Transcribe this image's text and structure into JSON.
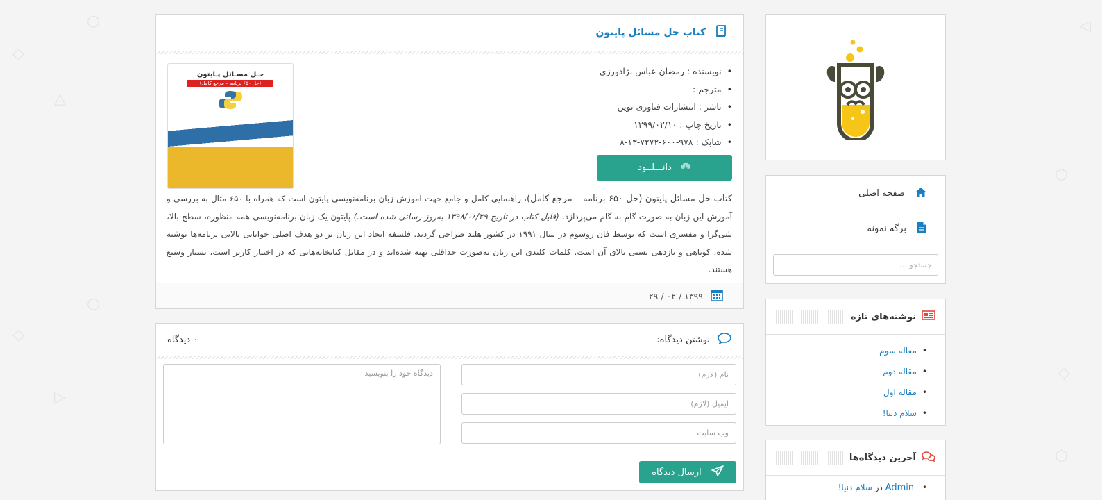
{
  "post": {
    "title": "کتاب حل مسائل پایتون",
    "meta": [
      "نویسنده : رمضان عباس نژادورزی",
      "مترجم : –",
      "ناشر : انتشارات فناوری نوین",
      "تاریخ چاپ : ۱۳۹۹/۰۲/۱۰",
      "شابک : ۹۷۸-۶۰۰-۷۲۷۲-۱۳-۸"
    ],
    "download_label": "دانـــلــود",
    "description_lead": "کتاب حل مسائل پایتون (حل ۶۵۰ برنامه – مرجع کامل)",
    "description_1": "، راهنمایی کامل و جامع جهت آموزش زبان برنامه‌نویسی پایتون است که همراه با ۶۵۰ مثال به بررسی و آموزش این زبان به صورت گام به گام می‌پردازد. ",
    "description_italic": "(فایل کتاب در تاریخ ۱۳۹۸/۰۸/۲۹ به‌روز رسانی شده است.)",
    "description_2": " پایتون یک زبان برنامه‌نویسی همه منظوره، سطح بالا، شی‌گرا و مفسری است که توسط فان روسوم در سال ۱۹۹۱ در کشور هلند طراحی گردید. فلسفه ایجاد این زبان بر دو هدف اصلی خوانایی بالایی برنامه‌ها نوشته شده، کوتاهی و بازدهی نسبی بالای آن است. کلمات کلیدی این زبان به‌صورت حداقلی تهیه شده‌اند و در مقابل کتابخانه‌هایی که در اختیار کاربر است، بسیار وسیع هستند.",
    "date": "۱۳۹۹ / ۰۲ / ۲۹",
    "cover": {
      "title": "حـل مسـائل پـایتون",
      "subtitle": "(حل ۶۵۰ برنامه – مرجع کامل)"
    }
  },
  "comments": {
    "title": "نوشتن دیدگاه:",
    "count": "۰ دیدگاه",
    "name_placeholder": "نام (لازم)",
    "email_placeholder": "ایمیل (لازم)",
    "website_placeholder": "وب سایت",
    "comment_placeholder": "دیدگاه خود را بنویسید",
    "submit_label": "ارسال دیدگاه"
  },
  "sidebar": {
    "nav": [
      {
        "label": "صفحه اصلی",
        "icon": "home-icon"
      },
      {
        "label": "برگه نمونه",
        "icon": "file-icon"
      }
    ],
    "search_placeholder": "جستجو ...",
    "recent_title": "نوشته‌های تازه",
    "recent_posts": [
      "مقاله سوم",
      "مقاله دوم",
      "مقاله اول",
      "سلام دنیا!"
    ],
    "recent_comments_title": "آخرین دیدگاه‌ها",
    "recent_comments": [
      {
        "author": "Admin",
        "connector": "در",
        "post": "سلام دنیا!"
      }
    ]
  },
  "colors": {
    "accent": "#2aa38e",
    "link": "#1a7fc1",
    "icon_red": "#e0483a"
  }
}
